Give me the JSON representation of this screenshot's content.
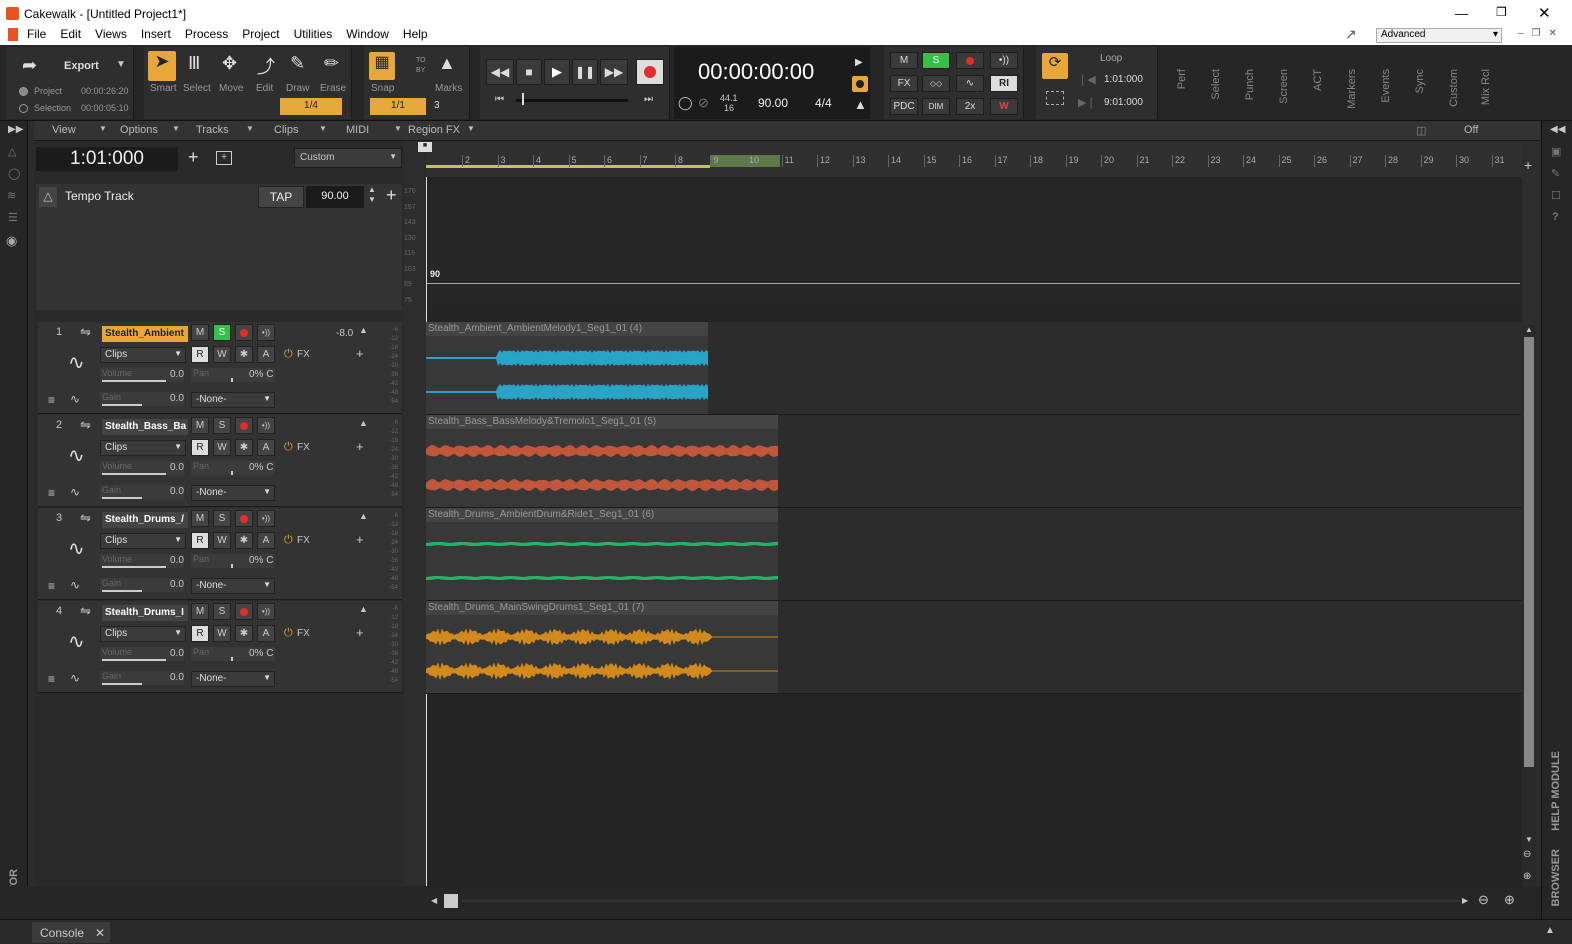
{
  "app": {
    "title": "Cakewalk - [Untitled Project1*]",
    "workspace": "Advanced"
  },
  "menu": [
    "File",
    "Edit",
    "Views",
    "Insert",
    "Process",
    "Project",
    "Utilities",
    "Window",
    "Help"
  ],
  "toolbar": {
    "export": "Export",
    "project_label": "Project",
    "project_time": "00:00:26:20",
    "selection_label": "Selection",
    "selection_time": "00:00:05:10",
    "tools": [
      "Smart",
      "Select",
      "Move",
      "Edit",
      "Draw",
      "Erase"
    ],
    "tool_value": "1/4",
    "snap": "Snap",
    "snap_value": "1/1",
    "snap_to": "TO",
    "snap_by": "BY",
    "marks": "Marks",
    "marks_value": "3",
    "time": "00:00:00:00",
    "sample_rate": "44.1",
    "bit_depth": "16",
    "tempo": "90.00",
    "meter": "4/4",
    "mix_m": "M",
    "mix_s": "S",
    "mix_fx": "FX",
    "mix_ri": "RI",
    "mix_pdc": "PDC",
    "mix_dim": "DIM",
    "mix_2x": "2x",
    "mix_w": "W",
    "loop": "Loop",
    "loop_start": "1:01:000",
    "loop_end": "9:01:000",
    "modules": [
      "Perf",
      "Select",
      "Punch",
      "Screen",
      "ACT",
      "Markers",
      "Events",
      "Sync",
      "Custom",
      "Mix Rcl"
    ]
  },
  "trackview": {
    "menus": [
      "View",
      "Options",
      "Tracks",
      "Clips",
      "MIDI",
      "Region FX"
    ],
    "now_time": "1:01:000",
    "workspace_preset": "Custom",
    "snap_off": "Off",
    "tempo_track": "Tempo Track",
    "tap": "TAP",
    "tempo_value": "90.00",
    "tempo_axis": [
      "170",
      "157",
      "143",
      "130",
      "116",
      "103",
      "89",
      "75"
    ],
    "tempo_marker": "90",
    "ruler": [
      "2",
      "3",
      "4",
      "5",
      "6",
      "7",
      "8",
      "9",
      "10",
      "11",
      "12",
      "13",
      "14",
      "15",
      "16",
      "17",
      "18",
      "19",
      "20",
      "21",
      "22",
      "23",
      "24",
      "25",
      "26",
      "27",
      "28",
      "29",
      "30",
      "31"
    ]
  },
  "tracks": [
    {
      "num": "1",
      "name": "Stealth_Ambient",
      "volume_label": "Volume",
      "volume": "0.0",
      "pan_label": "Pan",
      "pan": "0% C",
      "gain_label": "Gain",
      "gain": "0.0",
      "out": "-None-",
      "clips_label": "Clips",
      "db": "-8.0",
      "clip": "Stealth_Ambient_AmbientMelody1_Seg1_01 (4)",
      "color": "#29a3c6",
      "solo": true
    },
    {
      "num": "2",
      "name": "Stealth_Bass_Ba",
      "volume_label": "Volume",
      "volume": "0.0",
      "pan_label": "Pan",
      "pan": "0% C",
      "gain_label": "Gain",
      "gain": "0.0",
      "out": "-None-",
      "clips_label": "Clips",
      "db": "",
      "clip": "Stealth_Bass_BassMelody&Tremolo1_Seg1_01 (5)",
      "color": "#c0563a",
      "solo": false
    },
    {
      "num": "3",
      "name": "Stealth_Drums_/",
      "volume_label": "Volume",
      "volume": "0.0",
      "pan_label": "Pan",
      "pan": "0% C",
      "gain_label": "Gain",
      "gain": "0.0",
      "out": "-None-",
      "clips_label": "Clips",
      "db": "",
      "clip": "Stealth_Drums_AmbientDrum&Ride1_Seg1_01 (6)",
      "color": "#26b36a",
      "solo": false
    },
    {
      "num": "4",
      "name": "Stealth_Drums_I",
      "volume_label": "Volume",
      "volume": "0.0",
      "pan_label": "Pan",
      "pan": "0% C",
      "gain_label": "Gain",
      "gain": "0.0",
      "out": "-None-",
      "clips_label": "Clips",
      "db": "",
      "clip": "Stealth_Drums_MainSwingDrums1_Seg1_01 (7)",
      "color": "#d18a1e",
      "solo": false
    }
  ],
  "track_buttons": {
    "m": "M",
    "s": "S",
    "r": "R",
    "w": "W",
    "a": "A",
    "fx": "FX"
  },
  "meter_ticks": [
    "-6",
    "-12",
    "-18",
    "-24",
    "-30",
    "-36",
    "-42",
    "-48",
    "-54"
  ],
  "side": {
    "inspector": "INSPECTOR",
    "browser": "BROWSER",
    "help": "HELP MODULE"
  },
  "console": "Console"
}
